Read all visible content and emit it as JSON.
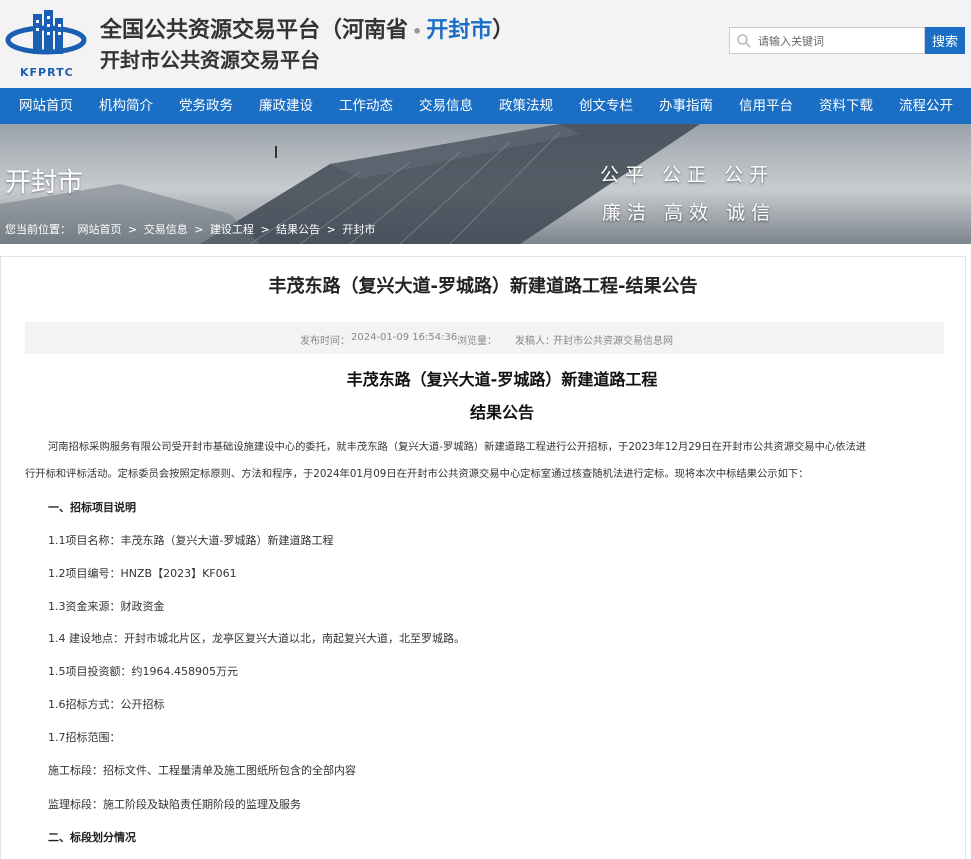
{
  "header": {
    "logo_text": "KFPRTC",
    "title_prefix": "全国公共资源交易平台（河南省",
    "title_dot": "•",
    "title_city": "开封市",
    "title_suffix": "）",
    "subtitle": "开封市公共资源交易平台",
    "search_placeholder": "请输入关键词",
    "search_button": "搜索",
    "brand_color": "#1a6fc4"
  },
  "nav": {
    "items": [
      "网站首页",
      "机构简介",
      "党务政务",
      "廉政建设",
      "工作动态",
      "交易信息",
      "政策法规",
      "创文专栏",
      "办事指南",
      "信用平台",
      "资料下载",
      "流程公开"
    ]
  },
  "banner": {
    "city": "开封市",
    "motto_line1": "公平 公正 公开",
    "motto_line2": "廉洁 高效 诚信",
    "breadcrumb": [
      "您当前位置：",
      "网站首页",
      ">",
      "交易信息",
      ">",
      "建设工程",
      ">",
      "结果公告",
      ">",
      "开封市"
    ]
  },
  "article": {
    "title": "丰茂东路（复兴大道-罗城路）新建道路工程-结果公告",
    "publish_label": "发布时间：",
    "publish_time": "2024-01-09 16:54:36",
    "views_label": "浏览量：",
    "author_label": "发稿人：",
    "author": "开封市公共资源交易信息网",
    "doc_title_1": "丰茂东路（复兴大道-罗城路）新建道路工程",
    "doc_title_2": "结果公告",
    "intro_line1": "河南招标采购服务有限公司受开封市基础设施建设中心的委托，就丰茂东路（复兴大道-罗城路）新建道路工程进行公开招标，于2023年12月29日在开封市公共资源交易中心依法进",
    "intro_line2": "行开标和评标活动。定标委员会按照定标原则、方法和程序，于2024年01月09日在开封市公共资源交易中心定标室通过核查随机法进行定标。现将本次中标结果公示如下：",
    "section1": "一、招标项目说明",
    "item_1_1": "1.1项目名称：丰茂东路（复兴大道-罗城路）新建道路工程",
    "item_1_2": "1.2项目编号：HNZB【2023】KF061",
    "item_1_3": "1.3资金来源：财政资金",
    "item_1_4": "1.4 建设地点：开封市城北片区，龙亭区复兴大道以北，南起复兴大道，北至罗城路。",
    "item_1_5": "1.5项目投资额：约1964.458905万元",
    "item_1_6": "1.6招标方式：公开招标",
    "item_1_7": "1.7招标范围：",
    "scope_construction": "施工标段：招标文件、工程量清单及施工图纸所包含的全部内容",
    "scope_supervision": "监理标段：施工阶段及缺陷责任期阶段的监理及服务",
    "section2": "二、标段划分情况"
  }
}
